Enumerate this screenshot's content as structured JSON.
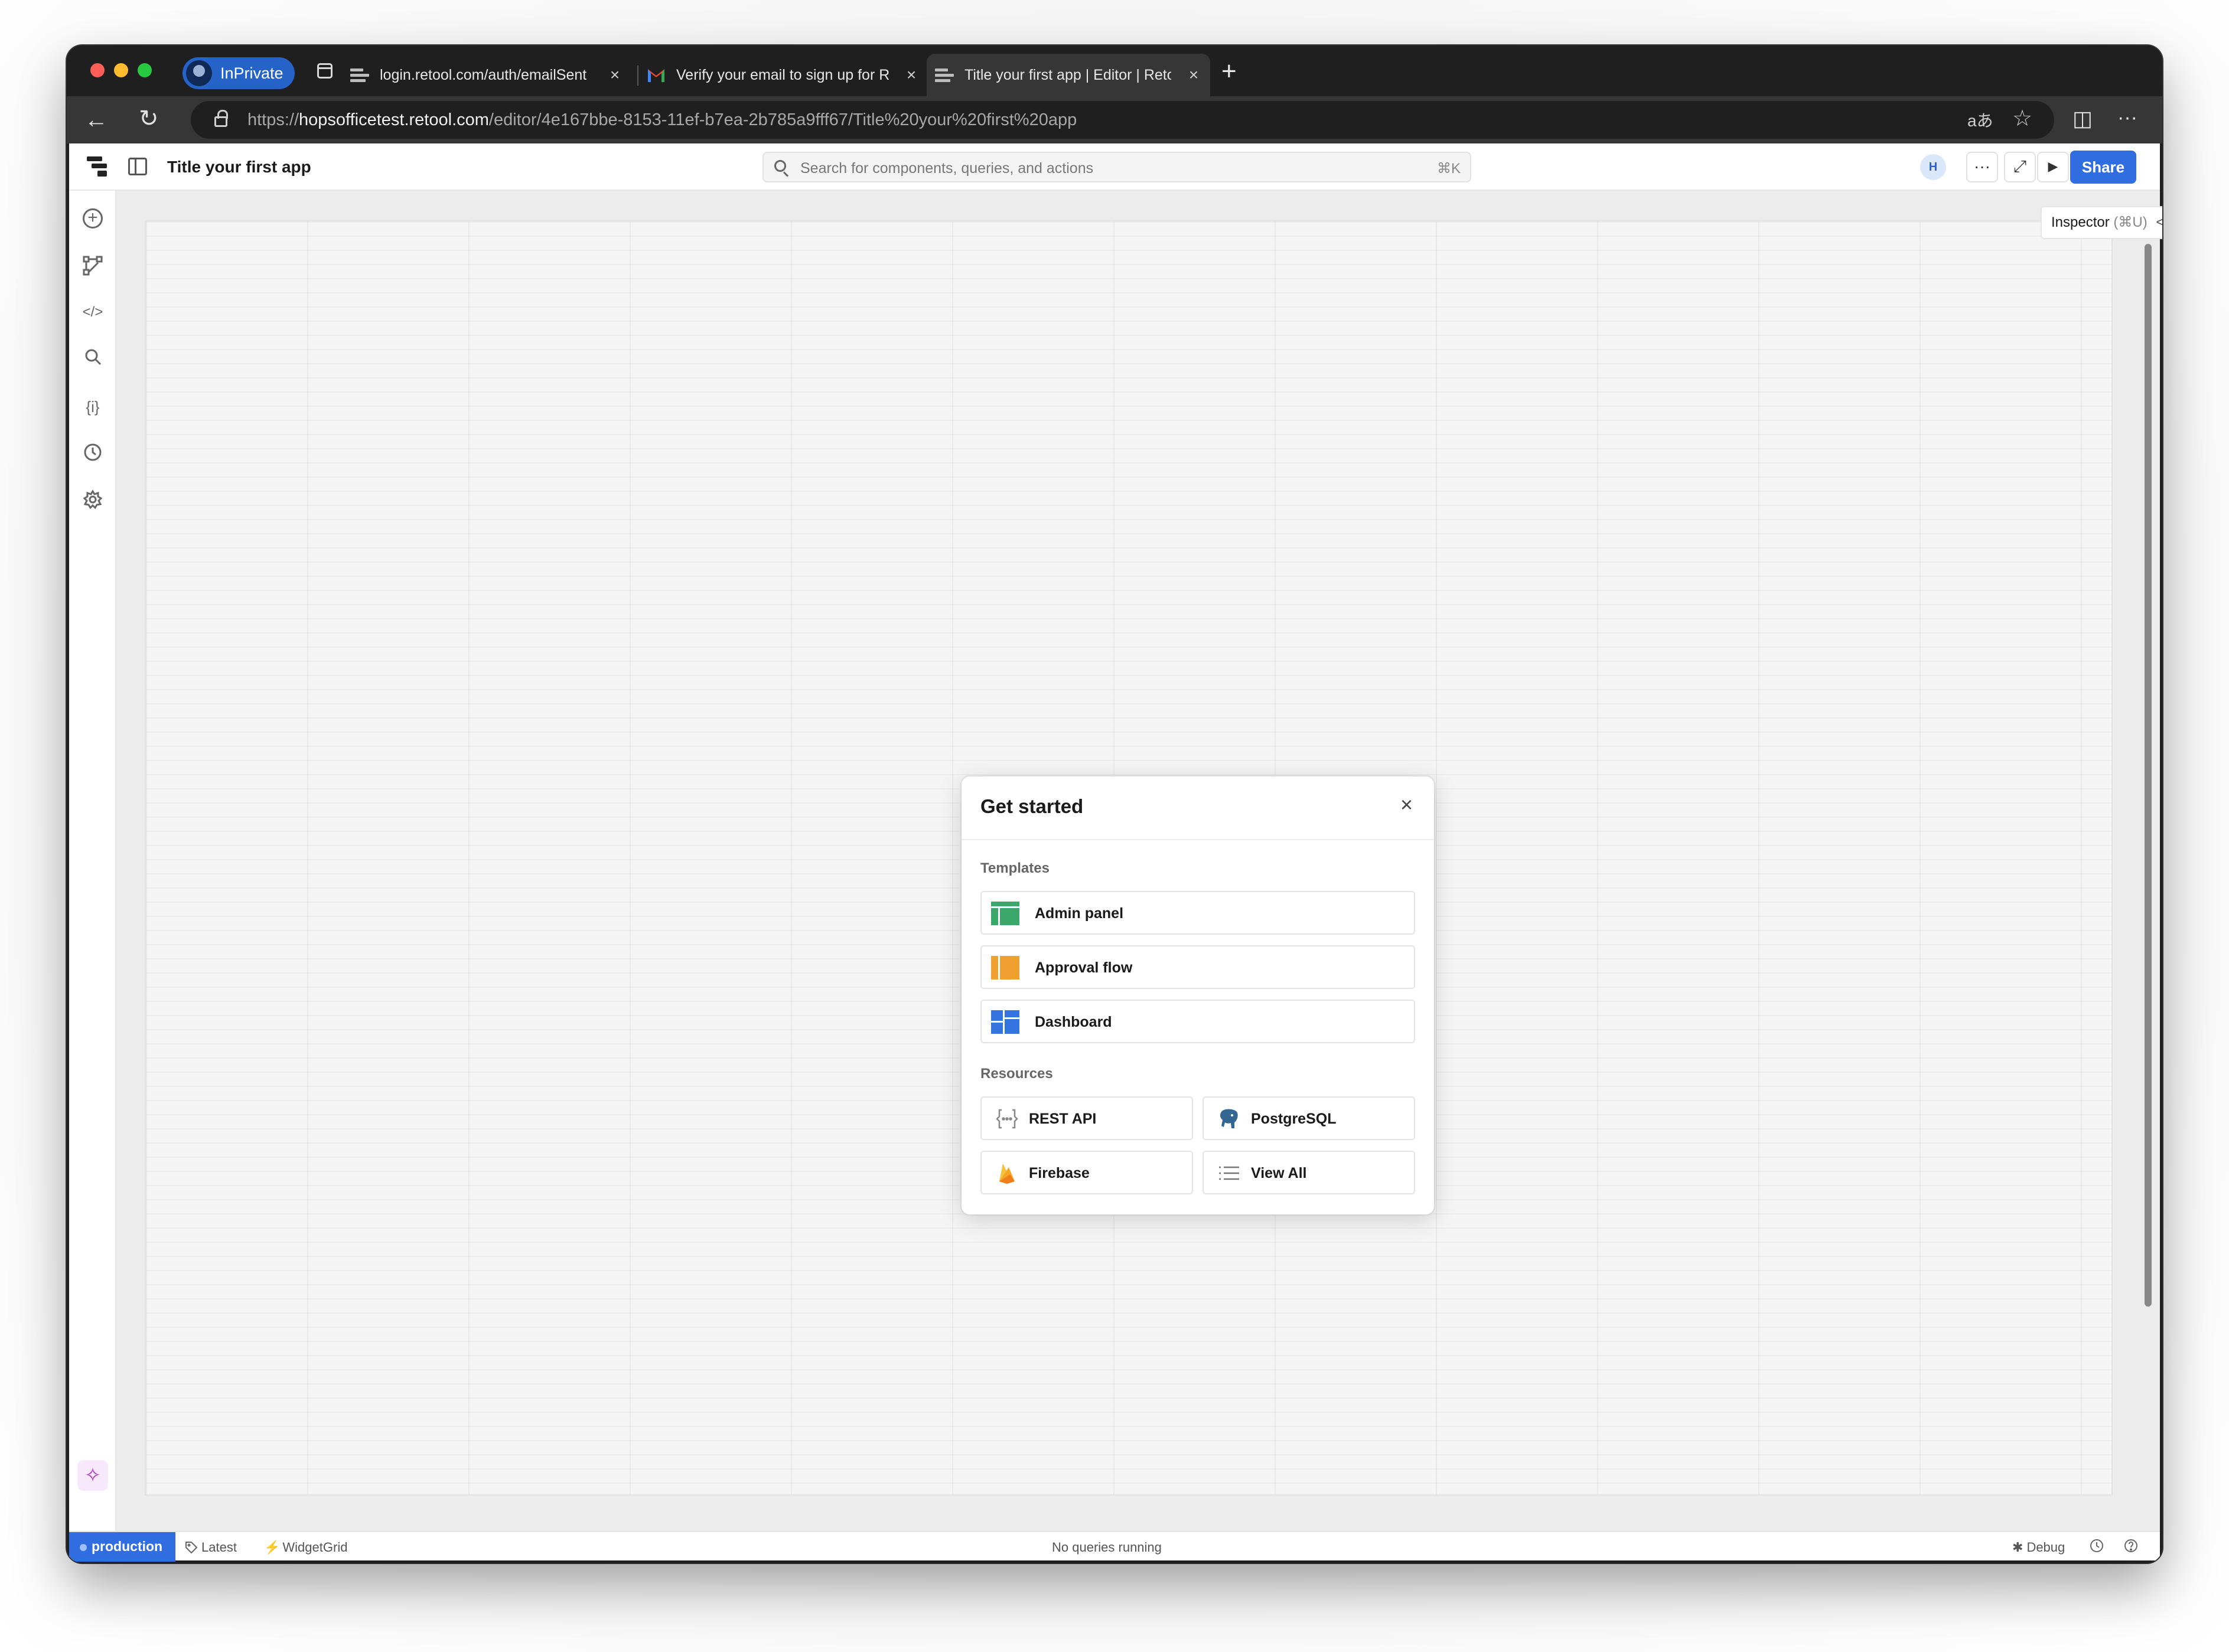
{
  "browser": {
    "private_label": "InPrivate",
    "tabs": [
      {
        "title": "login.retool.com/auth/emailSent",
        "close": "×"
      },
      {
        "title": "Verify your email to sign up for Retool",
        "close": "×"
      },
      {
        "title": "Title your first app | Editor | Retool",
        "close": "×"
      }
    ],
    "new_tab": "+",
    "url_prefix": "https://",
    "url_host": "hopsofficetest.retool.com",
    "url_path": "/editor/4e167bbe-8153-11ef-b7ea-2b785a9fff67/Title%20your%20first%20app",
    "nav": {
      "back": "←",
      "reload": "↻",
      "translate": "aあ",
      "favorite": "☆",
      "split": "◫",
      "more": "···"
    }
  },
  "app": {
    "title": "Title your first app",
    "search_placeholder": "Search for components, queries, and actions",
    "search_shortcut": "⌘K",
    "avatar_initial": "H",
    "more": "···",
    "expand": "⤢",
    "play": "▶",
    "share_label": "Share",
    "inspector_label": "Inspector",
    "inspector_shortcut": "(⌘U)",
    "inspector_collapse": "<<",
    "rail": {
      "add": "+",
      "code": "</>",
      "state": "{i}",
      "ai": "✧"
    }
  },
  "modal": {
    "title": "Get started",
    "close": "×",
    "templates_label": "Templates",
    "templates": [
      "Admin panel",
      "Approval flow",
      "Dashboard"
    ],
    "resources_label": "Resources",
    "resources": [
      "REST API",
      "PostgreSQL",
      "Firebase",
      "View All"
    ]
  },
  "statusbar": {
    "environment": "production",
    "version": "Latest",
    "widget": "WidgetGrid",
    "queries": "No queries running",
    "debug": "Debug"
  },
  "colors": {
    "accent": "#2f6de1",
    "admin_panel": "#3aa86b",
    "approval_flow": "#f0a030",
    "dashboard": "#3474e0",
    "firebase": "#f5a623"
  }
}
